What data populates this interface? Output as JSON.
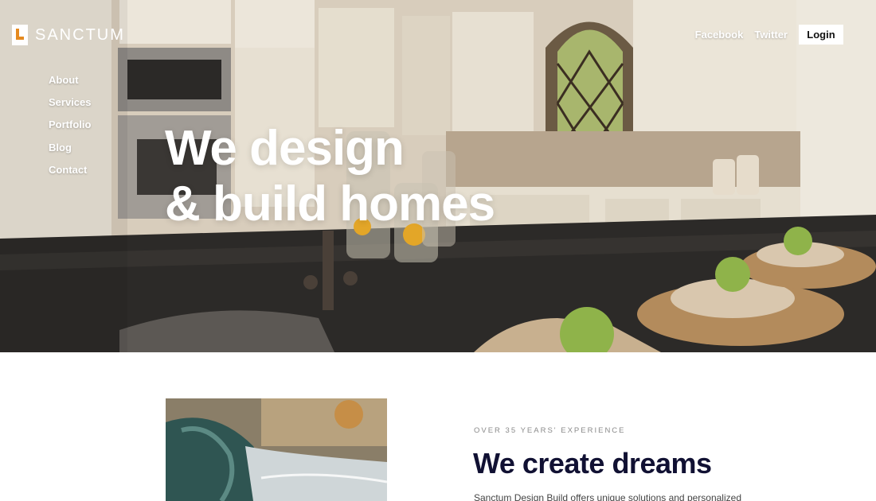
{
  "brand": {
    "name": "SANCTUM"
  },
  "nav": {
    "items": [
      "About",
      "Services",
      "Portfolio",
      "Blog",
      "Contact"
    ]
  },
  "top_links": {
    "facebook": "Facebook",
    "twitter": "Twitter",
    "login": "Login"
  },
  "hero": {
    "line1": "We design",
    "line2": "& build homes"
  },
  "about": {
    "eyebrow": "OVER 35 YEARS' EXPERIENCE",
    "title": "We create dreams",
    "body": "Sanctum Design Build offers unique solutions and personalized"
  },
  "colors": {
    "accent": "#e58a1f",
    "heading": "#111133",
    "hero_text": "#ffffff"
  }
}
